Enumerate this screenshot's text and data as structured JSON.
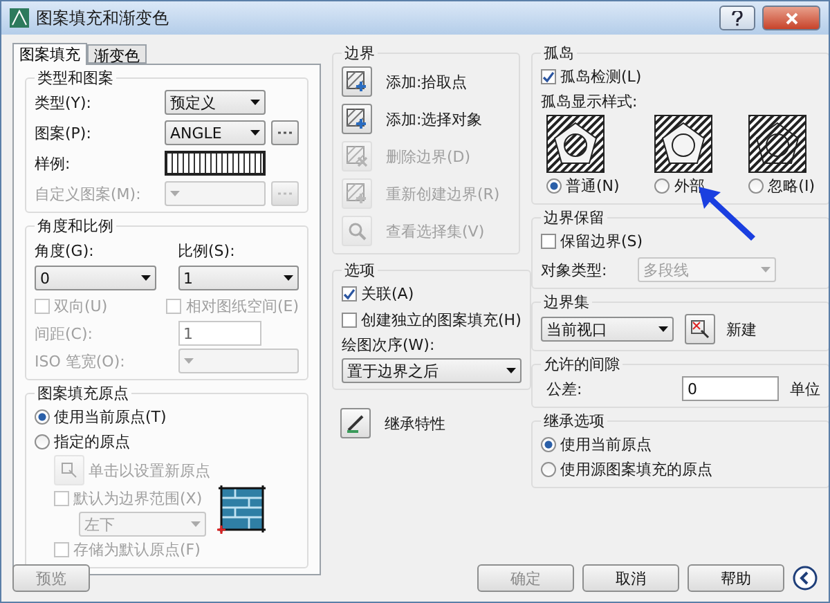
{
  "window": {
    "title": "图案填充和渐变色"
  },
  "tabs": [
    {
      "label": "图案填充",
      "selected": true
    },
    {
      "label": "渐变色",
      "selected": false
    }
  ],
  "type_and_pattern": {
    "title": "类型和图案",
    "rows": [
      {
        "kind": "select",
        "label": "类型(Y):",
        "value": "预定义",
        "disabled": false
      },
      {
        "kind": "select_browse",
        "label": "图案(P):",
        "value": "ANGLE",
        "disabled": false
      },
      {
        "kind": "swatch",
        "label": "样例:",
        "disabled": false
      },
      {
        "kind": "select_browse",
        "label": "自定义图案(M):",
        "disabled": true
      }
    ]
  },
  "angle_and_scale": {
    "title": "角度和比例",
    "angle": {
      "label": "角度(G):",
      "value": "0"
    },
    "scale": {
      "label": "比例(S):",
      "value": "1"
    },
    "checkboxes": [
      {
        "label": "双向(U)",
        "checked": false,
        "disabled": true
      },
      {
        "label": "相对图纸空间(E)",
        "checked": false,
        "disabled": true
      }
    ],
    "spacing": {
      "label": "间距(C):",
      "value": "1",
      "disabled": true
    },
    "iso_pen": {
      "label": "ISO 笔宽(O):",
      "disabled": true
    }
  },
  "origin": {
    "title": "图案填充原点",
    "radios": [
      {
        "label": "使用当前原点(T)",
        "selected": true
      },
      {
        "label": "指定的原点",
        "selected": false
      }
    ],
    "click_set": {
      "label": "单击以设置新原点",
      "disabled": true
    },
    "default_extent": {
      "label": "默认为边界范围(X)",
      "checked": false,
      "disabled": true
    },
    "extent_select": {
      "value": "左下",
      "disabled": true
    },
    "store_default": {
      "label": "存储为默认原点(F)",
      "checked": false,
      "disabled": true
    }
  },
  "preview_button": {
    "label": "预览",
    "disabled": true
  },
  "boundaries": {
    "title": "边界",
    "buttons": [
      {
        "label": "添加:拾取点",
        "kind": "pick",
        "disabled": false
      },
      {
        "label": "添加:选择对象",
        "kind": "select",
        "disabled": false
      },
      {
        "label": "删除边界(D)",
        "kind": "remove",
        "disabled": true
      },
      {
        "label": "重新创建边界(R)",
        "kind": "recreate",
        "disabled": true
      },
      {
        "label": "查看选择集(V)",
        "kind": "view",
        "disabled": true
      }
    ]
  },
  "options": {
    "title": "选项",
    "checkboxes": [
      {
        "label": "关联(A)",
        "checked": true,
        "disabled": false
      },
      {
        "label": "创建独立的图案填充(H)",
        "checked": false,
        "disabled": false
      }
    ],
    "draw_order": {
      "label": "绘图次序(W):",
      "value": "置于边界之后"
    }
  },
  "inherit_button": {
    "label": "继承特性"
  },
  "islands": {
    "title": "孤岛",
    "detect": {
      "label": "孤岛检测(L)",
      "checked": true,
      "disabled": false
    },
    "style_label": "孤岛显示样式:",
    "styles": [
      {
        "kind": "normal",
        "label": "普通(N)",
        "selected": true
      },
      {
        "kind": "outer",
        "label": "外部",
        "selected": false
      },
      {
        "kind": "ignore",
        "label": "忽略(I)",
        "selected": false
      }
    ]
  },
  "retain": {
    "title": "边界保留",
    "checkbox": {
      "label": "保留边界(S)",
      "checked": false,
      "disabled": false
    },
    "object_type": {
      "label": "对象类型:",
      "value": "多段线",
      "disabled": true
    }
  },
  "boundary_set": {
    "title": "边界集",
    "value": "当前视口",
    "new_label": "新建"
  },
  "gap": {
    "title": "允许的间隙",
    "label": "公差:",
    "value": "0",
    "unit": "单位"
  },
  "inherit_options": {
    "title": "继承选项",
    "radios": [
      {
        "label": "使用当前原点",
        "selected": true
      },
      {
        "label": "使用源图案填充的原点",
        "selected": false
      }
    ]
  },
  "footer_buttons": [
    {
      "label": "确定",
      "disabled": true
    },
    {
      "label": "取消",
      "disabled": false
    },
    {
      "label": "帮助",
      "disabled": false
    }
  ]
}
